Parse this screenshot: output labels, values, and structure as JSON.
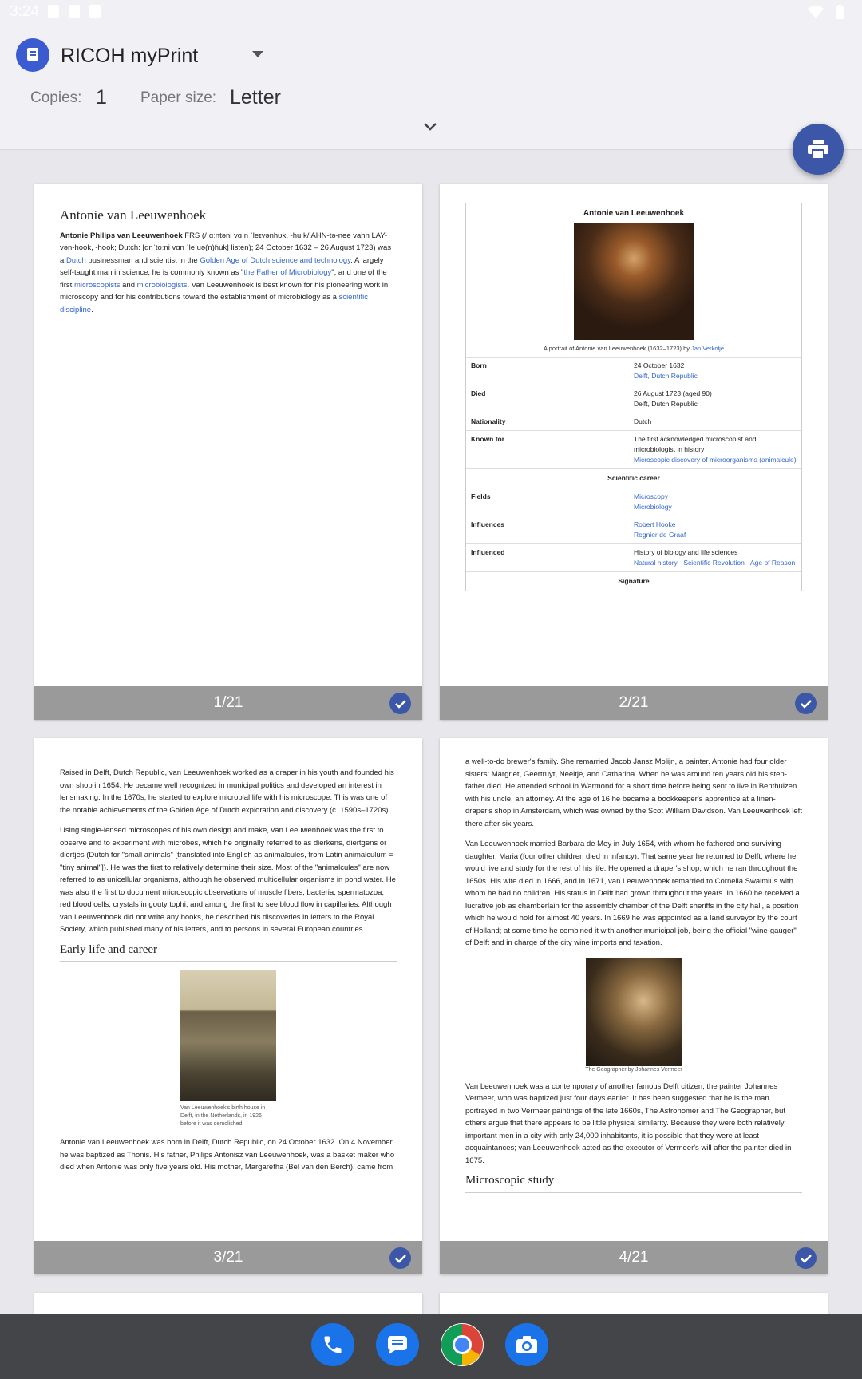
{
  "status_bar": {
    "time": "3:24"
  },
  "app": {
    "name": "RICOH myPrint",
    "icon_text": "RICOH"
  },
  "settings": {
    "copies_label": "Copies:",
    "copies_value": "1",
    "paper_label": "Paper size:",
    "paper_value": "Letter"
  },
  "pages": [
    {
      "label": "1/21",
      "checked": true
    },
    {
      "label": "2/21",
      "checked": true
    },
    {
      "label": "3/21",
      "checked": true
    },
    {
      "label": "4/21",
      "checked": true
    }
  ],
  "page1": {
    "title": "Antonie van Leeuwenhoek",
    "p1_a": "Antonie Philips van Leeuwenhoek",
    "p1_b": " FRS (/ˈɑːntəni vɑːn ˈleɪvənhʊk, -huːk/ AHN-tə-nee vahn LAY-vən-hook, -⁠hook; Dutch: [ɑnˈtoːni vɑn ˈleːuə(n)ɦuk] listen); 24 October 1632 – 26 August 1723) was a ",
    "p1_c": "Dutch",
    "p1_d": " businessman and scientist in the ",
    "p1_e": "Golden Age of Dutch science and technology",
    "p1_f": ". A largely self-taught man in science, he is commonly known as \"",
    "p1_g": "the Father of Microbiology",
    "p1_h": "\", and one of the first ",
    "p1_i": "microscopists",
    "p1_j": " and ",
    "p1_k": "microbiologists",
    "p1_l": ". Van Leeuwenhoek is best known for his pioneering work in microscopy and for his contributions toward the establishment of microbiology as a ",
    "p1_m": "scientific discipline",
    "p1_n": "."
  },
  "page2": {
    "title": "Antonie van Leeuwenhoek",
    "caption": "A portrait of Antonie van Leeuwenhoek (1632–1723) by ",
    "caption_link": "Jan Verkolje",
    "rows": [
      {
        "k": "Born",
        "v1": "24 October 1632",
        "v2": "Delft, Dutch Republic"
      },
      {
        "k": "Died",
        "v1": "26 August 1723 (aged 90)",
        "v2": "Delft, Dutch Republic"
      },
      {
        "k": "Nationality",
        "v1": "Dutch",
        "v2": ""
      },
      {
        "k": "Known for",
        "v1": "The first acknowledged microscopist and microbiologist in history",
        "v2": "Microscopic discovery of microorganisms (animalcule)"
      }
    ],
    "section": "Scientific career",
    "rows2": [
      {
        "k": "Fields",
        "v1": "Microscopy",
        "v2": "Microbiology"
      },
      {
        "k": "Influences",
        "v1": "Robert Hooke",
        "v2": "Regnier de Graaf"
      },
      {
        "k": "Influenced",
        "v1": "History of biology and life sciences",
        "v2": "Natural history · Scientific Revolution · Age of Reason"
      }
    ],
    "signature": "Signature"
  },
  "page3": {
    "p1": "Raised in Delft, Dutch Republic, van Leeuwenhoek worked as a draper in his youth and founded his own shop in 1654. He became well recognized in municipal politics and developed an interest in lensmaking. In the 1670s, he started to explore microbial life with his microscope. This was one of the notable achievements of the Golden Age of Dutch exploration and discovery (c. 1590s–1720s).",
    "p2": "Using single-lensed microscopes of his own design and make, van Leeuwenhoek was the first to observe and to experiment with microbes, which he originally referred to as dierkens, diertgens or diertjes (Dutch for \"small animals\" [translated into English as animalcules, from Latin animalculum = \"tiny animal\"]). He was the first to relatively determine their size. Most of the \"animalcules\" are now referred to as unicellular organisms, although he observed multicellular organisms in pond water. He was also the first to document microscopic observations of muscle fibers, bacteria, spermatozoa, red blood cells, crystals in gouty tophi, and among the first to see blood flow in capillaries. Although van Leeuwenhoek did not write any books, he described his discoveries in letters to the Royal Society, which published many of his letters, and to persons in several European countries.",
    "h2": "Early life and career",
    "img_caption": "Van Leeuwenhoek's birth house in Delft, in the Netherlands, in 1926 before it was demolished",
    "p3": "Antonie van Leeuwenhoek was born in Delft, Dutch Republic, on 24 October 1632. On 4 November, he was baptized as Thonis. His father, Philips Antonisz van Leeuwenhoek, was a basket maker who died when Antonie was only five years old. His mother, Margaretha (Bel van den Berch), came from"
  },
  "page4": {
    "p1": "a well-to-do brewer's family. She remarried Jacob Jansz Molijn, a painter. Antonie had four older sisters: Margriet, Geertruyt, Neeltje, and Catharina. When he was around ten years old his step-father died. He attended school in Warmond for a short time before being sent to live in Benthuizen with his uncle, an attorney. At the age of 16 he became a bookkeeper's apprentice at a linen-draper's shop in Amsterdam, which was owned by the Scot William Davidson. Van Leeuwenhoek left there after six years.",
    "p2": "Van Leeuwenhoek married Barbara de Mey in July 1654, with whom he fathered one surviving daughter, Maria (four other children died in infancy). That same year he returned to Delft, where he would live and study for the rest of his life. He opened a draper's shop, which he ran throughout the 1650s. His wife died in 1666, and in 1671, van Leeuwenhoek remarried to Cornelia Swalmius with whom he had no children. His status in Delft had grown throughout the years. In 1660 he received a lucrative job as chamberlain for the assembly chamber of the Delft sheriffs in the city hall, a position which he would hold for almost 40 years. In 1669 he was appointed as a land surveyor by the court of Holland; at some time he combined it with another municipal job, being the official \"wine-gauger\" of Delft and in charge of the city wine imports and taxation.",
    "img_caption": "The Geographer by Johannes Vermeer",
    "p3": "Van Leeuwenhoek was a contemporary of another famous Delft citizen, the painter Johannes Vermeer, who was baptized just four days earlier. It has been suggested that he is the man portrayed in two Vermeer paintings of the late 1660s, The Astronomer and The Geographer, but others argue that there appears to be little physical similarity. Because they were both relatively important men in a city with only 24,000 inhabitants, it is possible that they were at least acquaintances; van Leeuwenhoek acted as the executor of Vermeer's will after the painter died in 1675.",
    "h2": "Microscopic study"
  },
  "colors": {
    "accent": "#3c57a8",
    "header_bg": "#f0f0f5",
    "footer_bg": "#9a9a9a",
    "dock_bg": "#444549"
  },
  "dock": [
    {
      "name": "phone-app",
      "icon": "phone-icon",
      "color": "#1a73e8"
    },
    {
      "name": "messages-app",
      "icon": "messages-icon",
      "color": "#1a73e8"
    },
    {
      "name": "chrome-app",
      "icon": "chrome-icon",
      "color": "#ffffff"
    },
    {
      "name": "camera-app",
      "icon": "camera-icon",
      "color": "#1a73e8"
    }
  ]
}
